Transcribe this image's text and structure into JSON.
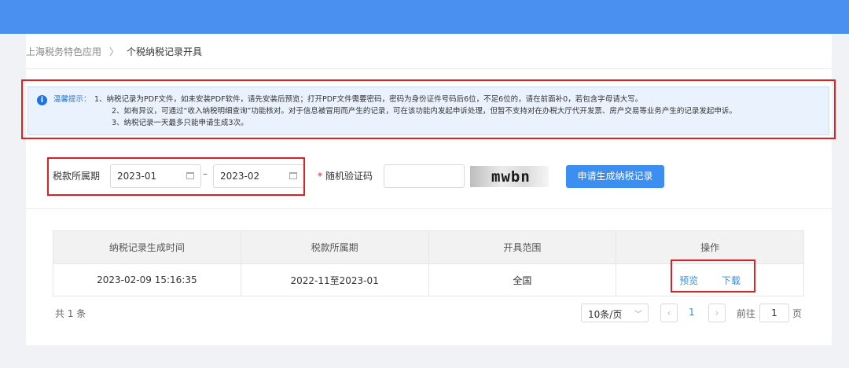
{
  "breadcrumb": {
    "parent": "上海税务特色应用",
    "separator": "〉",
    "current": "个税纳税记录开具"
  },
  "notice": {
    "label": "温馨提示：",
    "lines": [
      "1、纳税记录为PDF文件，如未安装PDF软件，请先安装后预览；打开PDF文件需要密码，密码为身份证件号码后6位，不足6位的，请在前面补0，若包含字母请大写。",
      "2、如有异议，可通过“收入纳税明细查询”功能核对。对于信息被冒用而产生的记录，可在该功能内发起申诉处理，但暂不支持对在办税大厅代开发票、房产交易等业务产生的记录发起申诉。",
      "3、纳税记录一天最多只能申请生成3次。"
    ]
  },
  "filter": {
    "period_label": "税款所属期",
    "start_date": "2023-01",
    "dash": "–",
    "end_date": "2023-02",
    "captcha_required_mark": "*",
    "captcha_label": "随机验证码",
    "captcha_value": "",
    "captcha_image_text": "mwbn",
    "submit_label": "申请生成纳税记录"
  },
  "table": {
    "headers": [
      "纳税记录生成时间",
      "税款所属期",
      "开具范围",
      "操作"
    ],
    "rows": [
      {
        "generated_at": "2023-02-09 15:16:35",
        "period": "2022-11至2023-01",
        "scope": "全国",
        "preview": "预览",
        "download": "下载"
      }
    ]
  },
  "pagination": {
    "total": "共 1 条",
    "page_size": "10条/页",
    "prev": "‹",
    "current_page": "1",
    "next": "›",
    "goto_label": "前往",
    "goto_value": "1",
    "suffix": "页"
  },
  "colors": {
    "header_bar": "#4a90f0",
    "primary": "#3c8ff0",
    "link": "#3a8ee6",
    "highlight": "#e02020"
  }
}
